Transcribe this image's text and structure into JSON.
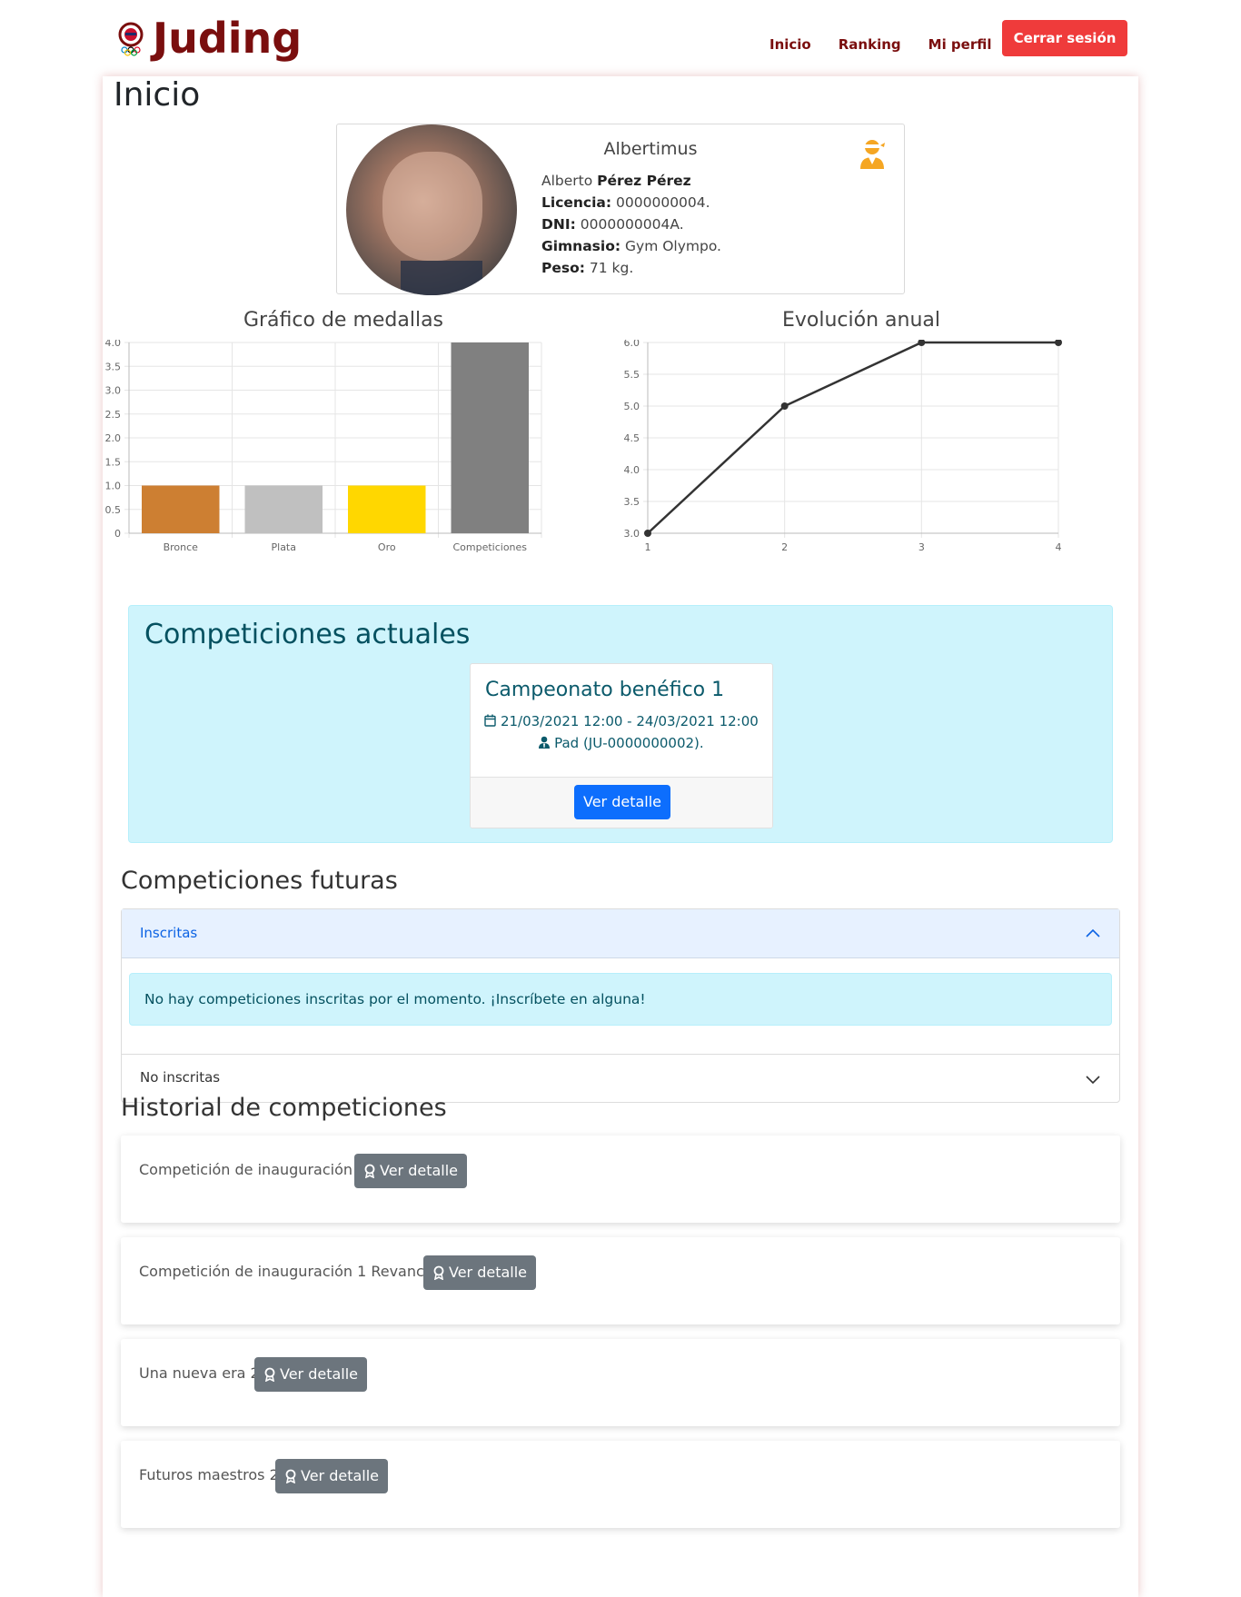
{
  "navbar": {
    "brand": "Juding",
    "links": [
      "Inicio",
      "Ranking",
      "Mi perfil"
    ],
    "logout": "Cerrar sesión"
  },
  "page_title": "Inicio",
  "profile": {
    "username": "Albertimus",
    "first_name": "Alberto",
    "last_name": "Pérez Pérez",
    "license_label": "Licencia:",
    "license": "0000000004.",
    "dni_label": "DNI:",
    "dni": "0000000004A.",
    "gym_label": "Gimnasio:",
    "gym": "Gym Olympo.",
    "weight_label": "Peso:",
    "weight": "71 kg.",
    "role_icon": "judoka-icon"
  },
  "chart_data": [
    {
      "type": "bar",
      "title": "Gráfico de medallas",
      "categories": [
        "Bronce",
        "Plata",
        "Oro",
        "Competiciones"
      ],
      "values": [
        1,
        1,
        1,
        4
      ],
      "colors": [
        "#cd7f32",
        "#c0c0c0",
        "#ffd700",
        "#808080"
      ],
      "ylim": [
        0,
        4
      ],
      "yticks": [
        "4.0",
        "3.5",
        "3.0",
        "2.5",
        "2.0",
        "1.5",
        "1.0",
        "0.5",
        "0"
      ],
      "grid": true
    },
    {
      "type": "line",
      "title": "Evolución anual",
      "x": [
        1,
        2,
        3,
        4
      ],
      "y": [
        3,
        5,
        6,
        6
      ],
      "ylim": [
        3,
        6
      ],
      "yticks": [
        "6.0",
        "5.5",
        "5.0",
        "4.5",
        "4.0",
        "3.5",
        "3.0"
      ],
      "xticks": [
        "1",
        "2",
        "3",
        "4"
      ],
      "color": "#333333",
      "grid": true
    }
  ],
  "current": {
    "title": "Competiciones actuales",
    "card": {
      "name": "Campeonato benéfico 1",
      "dates": "21/03/2021 12:00 - 24/03/2021 12:00",
      "owner": "Pad (JU-0000000002).",
      "button": "Ver detalle"
    }
  },
  "future": {
    "title": "Competiciones futuras",
    "registered_label": "Inscritas",
    "registered_empty": "No hay competiciones inscritas por el momento. ¡Inscríbete en alguna!",
    "unregistered_label": "No inscritas"
  },
  "history": {
    "title": "Historial de competiciones",
    "button": "Ver detalle",
    "items": [
      "Competición de inauguración 2",
      "Competición de inauguración 1 Revancha",
      "Una nueva era 2",
      "Futuros maestros 2"
    ]
  },
  "colors": {
    "brand": "#7a0e0e",
    "logout": "#ef3b3b",
    "primary": "#0d6efd",
    "secondary": "#6c757d",
    "info_bg": "#cff4fc"
  }
}
